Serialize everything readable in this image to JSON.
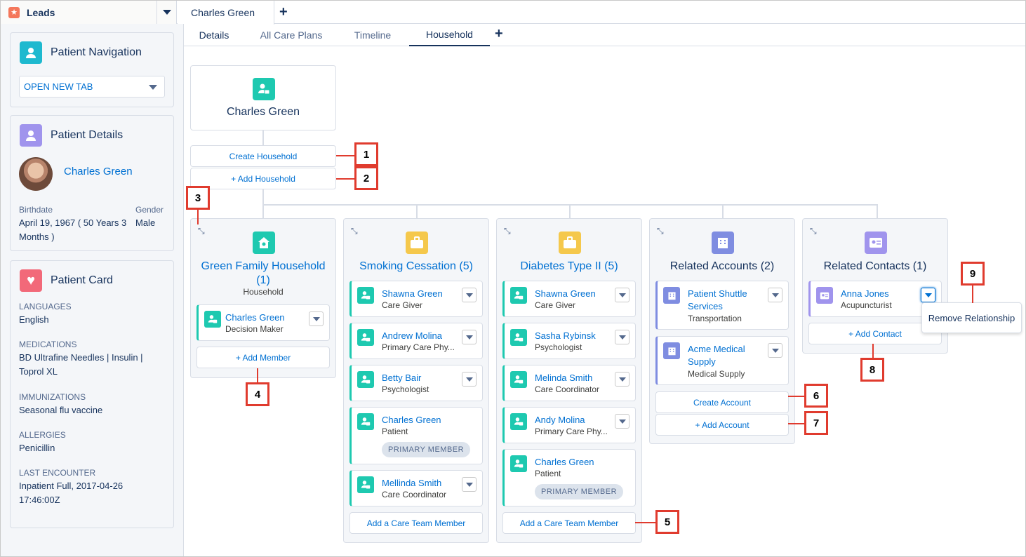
{
  "app": {
    "title": "Leads",
    "workspace_tab": "Charles Green"
  },
  "subtabs": [
    "Details",
    "All Care Plans",
    "Timeline",
    "Household"
  ],
  "sidebar": {
    "navigation": {
      "title": "Patient Navigation",
      "select_value": "OPEN NEW TAB"
    },
    "details": {
      "title": "Patient Details",
      "name": "Charles Green",
      "birthdate_label": "Birthdate",
      "birthdate_value": "April 19, 1967 ( 50 Years 3 Months )",
      "gender_label": "Gender",
      "gender_value": "Male"
    },
    "card": {
      "title": "Patient Card",
      "fields": [
        {
          "label": "LANGUAGES",
          "value": "English"
        },
        {
          "label": "MEDICATIONS",
          "value": "BD Ultrafine Needles | Insulin | Toprol XL"
        },
        {
          "label": "IMMUNIZATIONS",
          "value": "Seasonal flu vaccine"
        },
        {
          "label": "ALLERGIES",
          "value": "Penicillin"
        },
        {
          "label": "LAST ENCOUNTER",
          "value": "Inpatient Full, 2017-04-26 17:46:00Z"
        }
      ]
    }
  },
  "root": {
    "name": "Charles Green",
    "create_household": "Create Household",
    "add_household": "+ Add Household"
  },
  "household": {
    "title": "Green Family Household (1)",
    "subtitle": "Household",
    "member_name": "Charles Green",
    "member_role": "Decision Maker",
    "add_member": "+ Add Member"
  },
  "smoking": {
    "title": "Smoking Cessation (5)",
    "members": [
      {
        "name": "Shawna Green",
        "role": "Care Giver"
      },
      {
        "name": "Andrew Molina",
        "role": "Primary Care Phy..."
      },
      {
        "name": "Betty Bair",
        "role": "Psychologist"
      },
      {
        "name": "Charles Green",
        "role": "Patient",
        "pill": "PRIMARY MEMBER"
      },
      {
        "name": "Mellinda Smith",
        "role": "Care Coordinator"
      }
    ],
    "add_label": "Add a Care Team Member"
  },
  "diabetes": {
    "title": "Diabetes Type II (5)",
    "members": [
      {
        "name": "Shawna Green",
        "role": "Care Giver"
      },
      {
        "name": "Sasha Rybinsk",
        "role": "Psychologist"
      },
      {
        "name": "Melinda Smith",
        "role": "Care Coordinator"
      },
      {
        "name": "Andy Molina",
        "role": "Primary Care Phy..."
      },
      {
        "name": "Charles Green",
        "role": "Patient",
        "pill": "PRIMARY MEMBER"
      }
    ],
    "add_label": "Add a Care Team Member"
  },
  "accounts": {
    "title": "Related Accounts (2)",
    "items": [
      {
        "name": "Patient Shuttle Services",
        "type": "Transportation"
      },
      {
        "name": "Acme Medical Supply",
        "type": "Medical Supply"
      }
    ],
    "create_label": "Create Account",
    "add_label": "+ Add Account"
  },
  "contacts": {
    "title": "Related Contacts (1)",
    "name": "Anna Jones",
    "role": "Acupuncturist",
    "add_label": "+ Add Contact",
    "popover": "Remove Relationship"
  },
  "callouts": [
    "1",
    "2",
    "3",
    "4",
    "5",
    "6",
    "7",
    "8",
    "9"
  ],
  "colors": {
    "accent": "#0070d2",
    "teal": "#1ec9b0",
    "gold": "#f5c84c",
    "callout": "#e03b2e"
  }
}
